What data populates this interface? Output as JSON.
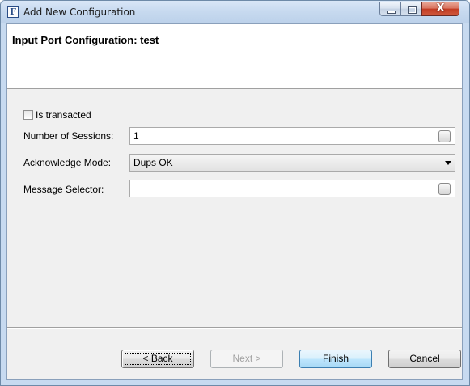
{
  "window": {
    "title": "Add New Configuration",
    "app_icon_letter": "F",
    "controls": {
      "minimize": "minimize",
      "maximize": "maximize",
      "close": "X"
    }
  },
  "header": {
    "title": "Input Port Configuration: test"
  },
  "form": {
    "is_transacted": {
      "label": "Is transacted",
      "checked": false
    },
    "number_of_sessions": {
      "label": "Number of Sessions:",
      "value": "1"
    },
    "acknowledge_mode": {
      "label": "Acknowledge Mode:",
      "value": "Dups OK"
    },
    "message_selector": {
      "label": "Message Selector:",
      "value": ""
    }
  },
  "buttons": {
    "back": {
      "prefix": "< ",
      "mnemonic": "B",
      "rest": "ack"
    },
    "next": {
      "mnemonic": "N",
      "rest": "ext >"
    },
    "finish": {
      "mnemonic": "F",
      "rest": "inish"
    },
    "cancel": {
      "label": "Cancel"
    }
  }
}
